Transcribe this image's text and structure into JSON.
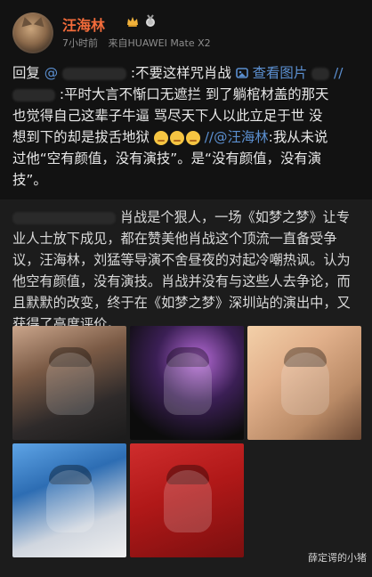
{
  "header": {
    "username": "汪海林",
    "time": "7小时前",
    "source": "来自HUAWEI Mate X2"
  },
  "main": {
    "line1": {
      "reply_prefix": "回复",
      "mention": "@",
      "text": ":不要这样咒肖战",
      "view_image": "查看图片",
      "tail": "//"
    },
    "line2": ":平时大言不惭口无遮拦 到了躺棺材盖的那天",
    "line3": "也觉得自己这辈子牛逼 骂尽天下人以此立足于世 没",
    "line4": {
      "text": "想到下的却是拔舌地狱",
      "mention2": "//@汪海林",
      "tail": ":我从未说"
    },
    "line5": "过他“空有颜值，没有演技”。是“没有颜值，没有演",
    "line6": "技”。"
  },
  "retweet": {
    "text": "肖战是个狠人，一场《如梦之梦》让专业人士放下成见，都在赞美他肖战这个顶流一直备受争议，汪海林，刘猛等导演不舍昼夜的对起冷嘲热讽。认为他空有颜值，没有演技。肖战并没有与这些人去争论，而且默默的改变，终于在《如梦之梦》深圳站的演出中，又获得了高度评价。"
  },
  "images": [
    {
      "label": "photo-1"
    },
    {
      "label": "photo-2"
    },
    {
      "label": "photo-3"
    },
    {
      "label": "photo-4"
    },
    {
      "label": "photo-5"
    }
  ],
  "watermark": "薛定谔的小猪"
}
